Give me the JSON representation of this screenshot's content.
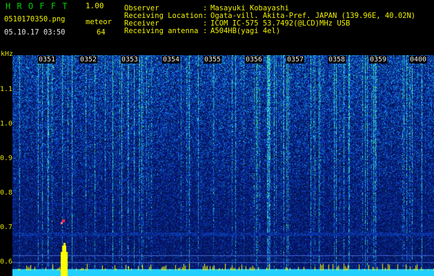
{
  "header": {
    "app_name": "H R O F F T",
    "version": "1.00",
    "filename": "0510170350.png",
    "datetime": "05.10.17 03:50",
    "meteor_label": "meteor",
    "meteor_count": "64",
    "info_rows": [
      {
        "label": "Observer",
        "sep": ":",
        "value": "Masayuki Kobayashi"
      },
      {
        "label": "Receiving Location",
        "sep": ":",
        "value": "Ogata-vill. Akita-Pref. JAPAN (139.96E, 40.02N)"
      },
      {
        "label": "Receiver",
        "sep": ":",
        "value": "ICOM IC-575 53.7492(@LCD)MHz USB"
      },
      {
        "label": "Receiving antenna",
        "sep": ":",
        "value": "A504HB(yagi 4el)"
      }
    ]
  },
  "spectrogram": {
    "y_unit": "kHz",
    "y_ticks": [
      "1.1",
      "1.0",
      "0.9",
      "0.8",
      "0.7",
      "0.6"
    ],
    "time_labels": [
      "0351",
      "0352",
      "0353",
      "0354",
      "0355",
      "0356",
      "0357",
      "0358",
      "0359",
      "0400"
    ],
    "colors": {
      "background": "#000000",
      "text_yellow": "#f2f200",
      "text_green": "#00d000",
      "noise_base": "#08104a",
      "meteor": "#ffff00"
    }
  }
}
